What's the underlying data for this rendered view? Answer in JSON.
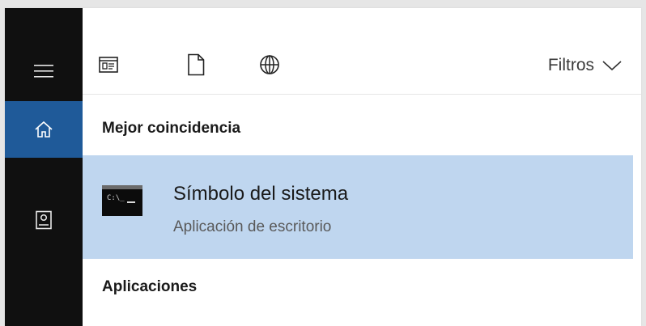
{
  "rail": {
    "items": [
      {
        "name": "menu",
        "icon": "hamburger-menu-icon"
      },
      {
        "name": "home",
        "icon": "home-icon",
        "active": true
      },
      {
        "name": "notebook",
        "icon": "notebook-icon"
      }
    ],
    "active_color": "#1f5a99",
    "background": "#101010"
  },
  "toolbar": {
    "icons": [
      "apps-filter-icon",
      "documents-filter-icon",
      "web-filter-icon"
    ],
    "filters_label": "Filtros"
  },
  "best_match": {
    "heading": "Mejor coincidencia",
    "item": {
      "title": "Símbolo del sistema",
      "subtitle": "Aplicación de escritorio",
      "icon": "command-prompt-icon",
      "icon_text": "C:\\_",
      "highlight_color": "#bfd6ef"
    }
  },
  "apps_section": {
    "heading": "Aplicaciones"
  }
}
